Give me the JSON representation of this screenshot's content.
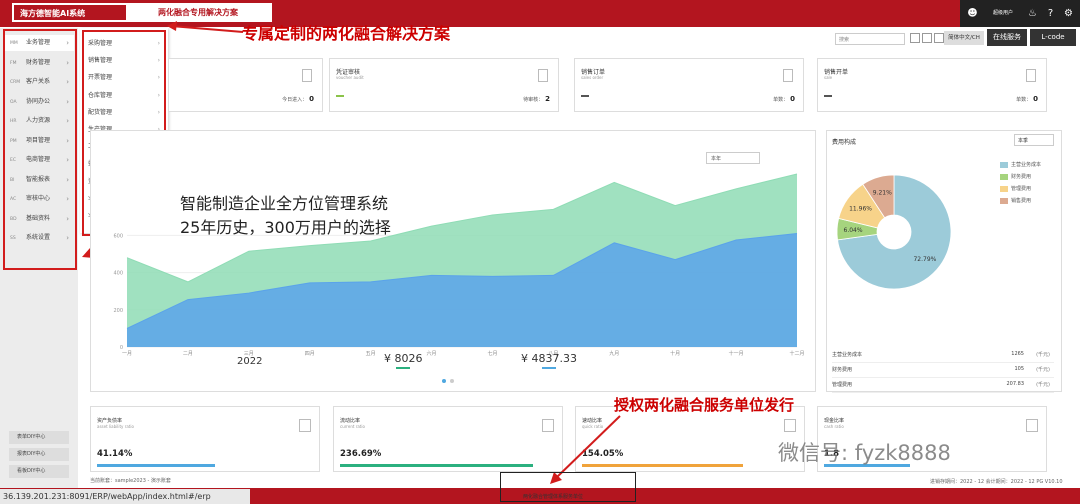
{
  "topbar": {
    "brand": "海方德智能AI系统",
    "brand_sub": "两化融合专用解决方案",
    "user": "超级用户"
  },
  "callouts": {
    "tagline_top": "专属定制的两化融合解决方案",
    "tagline_mid1": "智能制造企业全方位管理系统",
    "tagline_mid2": "25年历史，300万用户的选择",
    "tagline_bottom": "授权两化融合服务单位发行"
  },
  "toolbar": {
    "select_placeholder": "搜索",
    "lang": "简体中文/CH",
    "online": "在线服务",
    "lcode": "L-code"
  },
  "sidebar": {
    "items": [
      {
        "code": "MM",
        "label": "业务管理"
      },
      {
        "code": "FM",
        "label": "财务管理"
      },
      {
        "code": "CRM",
        "label": "客户关系"
      },
      {
        "code": "OA",
        "label": "协同办公"
      },
      {
        "code": "HR",
        "label": "人力资源"
      },
      {
        "code": "PM",
        "label": "项目管理"
      },
      {
        "code": "EC",
        "label": "电商管理"
      },
      {
        "code": "BI",
        "label": "智能报表"
      },
      {
        "code": "AC",
        "label": "审核中心"
      },
      {
        "code": "BD",
        "label": "基础资料"
      },
      {
        "code": "SS",
        "label": "系统设置"
      }
    ],
    "bottom": [
      "表单DIY中心",
      "报表DIY中心",
      "看板DIY中心"
    ]
  },
  "submenu": {
    "items": [
      "采购管理",
      "销售管理",
      "开票管理",
      "仓库管理",
      "配货管理",
      "生产管理",
      "工序管理",
      "委托加工",
      "资金往来",
      "业务报表",
      "业务智能化"
    ]
  },
  "kpis": [
    {
      "title": "凭证审核",
      "sub": "voucher audit",
      "label": "待审核：",
      "value": "2",
      "color": "#8bc34a"
    },
    {
      "title": "销售订单",
      "sub": "sales order",
      "label": "单数：",
      "value": "0",
      "color": "#555"
    },
    {
      "title": "销售开单",
      "sub": "sale",
      "label": "单数：",
      "value": "0",
      "color": "#555"
    }
  ],
  "kpi_first": {
    "label": "今日进入：",
    "value": "0"
  },
  "chart": {
    "select": "本年",
    "year": "2022",
    "amount1": "¥ 8026",
    "amount2": "¥ 4837.33"
  },
  "chart_data": {
    "type": "area",
    "categories": [
      "一月",
      "二月",
      "三月",
      "四月",
      "五月",
      "六月",
      "七月",
      "八月",
      "九月",
      "十月",
      "十一月",
      "十二月"
    ],
    "series": [
      {
        "values": [
          100,
          255,
          290,
          345,
          350,
          385,
          380,
          385,
          560,
          470,
          575,
          610
        ],
        "color": "#5aa3ea"
      },
      {
        "values": [
          480,
          350,
          515,
          545,
          570,
          650,
          710,
          740,
          885,
          760,
          850,
          930
        ],
        "color": "#8fdcb5"
      }
    ],
    "ylim": [
      0,
      1000
    ],
    "yticks": [
      0,
      200,
      400,
      600
    ],
    "grid": true
  },
  "pie": {
    "title": "费用构成",
    "select": "本季",
    "legend": [
      {
        "label": "主营业务成本",
        "color": "#9ccbd9"
      },
      {
        "label": "财务费用",
        "color": "#a6d47e"
      },
      {
        "label": "管理费用",
        "color": "#f7d38a"
      },
      {
        "label": "销售费用",
        "color": "#dcaa91"
      }
    ],
    "rows": [
      {
        "label": "主营业务成本",
        "value": "1265",
        "unit": "(千元)"
      },
      {
        "label": "财务费用",
        "value": "105",
        "unit": "(千元)"
      },
      {
        "label": "管理费用",
        "value": "207.83",
        "unit": "(千元)"
      }
    ],
    "slices": [
      {
        "label": "72.79%",
        "value": 72.79,
        "color": "#9ccbd9"
      },
      {
        "label": "6.04%",
        "value": 6.04,
        "color": "#a6d47e"
      },
      {
        "label": "11.96%",
        "value": 11.96,
        "color": "#f7d38a"
      },
      {
        "label": "9.21%",
        "value": 9.21,
        "color": "#dcaa91"
      }
    ]
  },
  "stats": [
    {
      "title": "资产负债率",
      "sub": "asset liability ratio",
      "value": "41.14%",
      "color": "#4fa8e0"
    },
    {
      "title": "流动比率",
      "sub": "current ratio",
      "value": "236.69%",
      "color": "#2bb07f"
    },
    {
      "title": "速动比率",
      "sub": "quick ratio",
      "value": "154.05%",
      "color": "#f0a33b"
    },
    {
      "title": "现金比率",
      "sub": "cash ratio",
      "value": "1.8",
      "color": "#4fa8e0"
    }
  ],
  "footer": {
    "left": "当前账套：sample2023 - 演示账套",
    "right": "进销存期间：2022 - 12       会计期间：2022 - 12       PG  V10.10",
    "url": "36.139.201.231:8091/ERP/webApp/index.html#/erp",
    "center": "两化融合管理体系服务单位"
  },
  "watermark": "微信号: fyzk8888"
}
